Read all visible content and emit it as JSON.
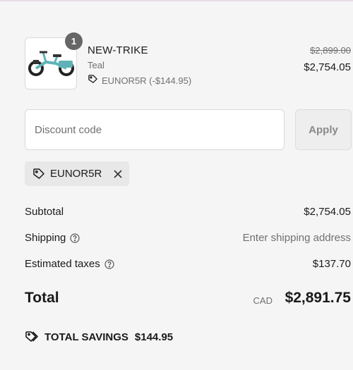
{
  "product": {
    "quantity": "1",
    "name": "NEW-TRIKE",
    "variant": "Teal",
    "discount_line": "EUNOR5R (-$144.95)",
    "original_price": "$2,899.00",
    "discounted_price": "$2,754.05"
  },
  "discount": {
    "placeholder": "Discount code",
    "apply_label": "Apply",
    "applied_code": "EUNOR5R"
  },
  "summary": {
    "subtotal_label": "Subtotal",
    "subtotal_value": "$2,754.05",
    "shipping_label": "Shipping",
    "shipping_value": "Enter shipping address",
    "taxes_label": "Estimated taxes",
    "taxes_value": "$137.70",
    "total_label": "Total",
    "currency": "CAD",
    "total_value": "$2,891.75"
  },
  "savings": {
    "label": "TOTAL SAVINGS",
    "amount": "$144.95"
  },
  "icons": {
    "tag": "tag-icon",
    "remove": "close-icon",
    "help": "question-circle-icon",
    "savings": "tags-icon"
  },
  "colors": {
    "background": "#f5f5f5",
    "muted_text": "#707070",
    "badge": "#666666",
    "bike_frame": "#5fb3b8"
  }
}
